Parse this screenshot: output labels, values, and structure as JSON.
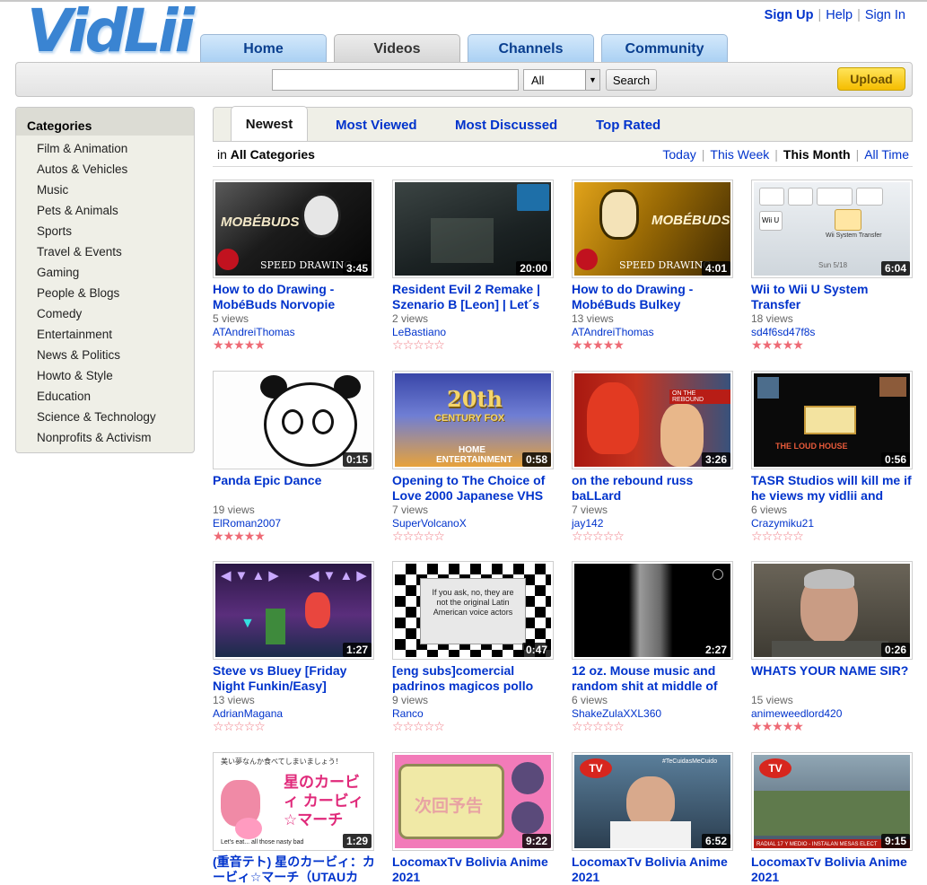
{
  "brand": {
    "logo": "VidLii"
  },
  "header": {
    "links": {
      "signup": "Sign Up",
      "help": "Help",
      "signin": "Sign In"
    },
    "tabs": [
      "Home",
      "Videos",
      "Channels",
      "Community"
    ]
  },
  "search": {
    "value": "",
    "category": "All",
    "button": "Search",
    "upload": "Upload"
  },
  "sidebar": {
    "title": "Categories",
    "items": [
      "Film & Animation",
      "Autos & Vehicles",
      "Music",
      "Pets & Animals",
      "Sports",
      "Travel & Events",
      "Gaming",
      "People & Blogs",
      "Comedy",
      "Entertainment",
      "News & Politics",
      "Howto & Style",
      "Education",
      "Science & Technology",
      "Nonprofits & Activism"
    ]
  },
  "subtabs": [
    "Newest",
    "Most Viewed",
    "Most Discussed",
    "Top Rated"
  ],
  "filter": {
    "prefix": "in",
    "category": "All Categories",
    "time": [
      "Today",
      "This Week",
      "This Month",
      "All Time"
    ]
  },
  "videos": [
    {
      "title": "How to do Drawing - MobéBuds Norvopie",
      "duration": "3:45",
      "views": "5 views",
      "user": "ATAndreiThomas",
      "rating": 5
    },
    {
      "title": "Resident Evil 2 Remake | Szenario B [Leon] | Let´s",
      "duration": "20:00",
      "views": "2 views",
      "user": "LeBastiano",
      "rating": 0
    },
    {
      "title": "How to do Drawing - MobéBuds Bulkey",
      "duration": "4:01",
      "views": "13 views",
      "user": "ATAndreiThomas",
      "rating": 5
    },
    {
      "title": "Wii to Wii U System Transfer",
      "duration": "6:04",
      "views": "18 views",
      "user": "sd4f6sd47f8s",
      "rating": 5
    },
    {
      "title": "Panda Epic Dance",
      "duration": "0:15",
      "views": "19 views",
      "user": "ElRoman2007",
      "rating": 5
    },
    {
      "title": "Opening to The Choice of Love 2000 Japanese VHS",
      "duration": "0:58",
      "views": "7 views",
      "user": "SuperVolcanoX",
      "rating": 0
    },
    {
      "title": "on the rebound russ baLLard",
      "duration": "3:26",
      "views": "7 views",
      "user": "jay142",
      "rating": 0
    },
    {
      "title": "TASR Studios will kill me if he views my vidlii and",
      "duration": "0:56",
      "views": "6 views",
      "user": "Crazymiku21",
      "rating": 0
    },
    {
      "title": "Steve vs Bluey [Friday Night Funkin/Easy]",
      "duration": "1:27",
      "views": "13 views",
      "user": "AdrianMagana",
      "rating": 0
    },
    {
      "title": "[eng subs]comercial padrinos magicos pollo",
      "duration": "0:47",
      "views": "9 views",
      "user": "Ranco",
      "rating": 0
    },
    {
      "title": "12 oz. Mouse music and random shit at middle of",
      "duration": "2:27",
      "views": "6 views",
      "user": "ShakeZulaXXL360",
      "rating": 0
    },
    {
      "title": "WHATS YOUR NAME SIR?",
      "duration": "0:26",
      "views": "15 views",
      "user": "animeweedlord420",
      "rating": 5
    },
    {
      "title": "(重音テト) 星のカービィ：カービィ☆マーチ（UTAUカ",
      "duration": "1:29",
      "views": "",
      "user": "",
      "rating": 0
    },
    {
      "title": "LocomaxTv Bolivia Anime 2021",
      "duration": "9:22",
      "views": "",
      "user": "",
      "rating": 0
    },
    {
      "title": "LocomaxTv Bolivia Anime 2021",
      "duration": "6:52",
      "views": "",
      "user": "",
      "rating": 0
    },
    {
      "title": "LocomaxTv Bolivia Anime 2021",
      "duration": "9:15",
      "views": "",
      "user": "",
      "rating": 0
    }
  ],
  "thumb_text": {
    "mobe": "MOBÉBUDS",
    "speed": "SPEED DRAWING",
    "wii": "Wii U",
    "wii_caption": "Wii System Transfer",
    "wii_date": "Sun 5/18",
    "fox_top": "20th",
    "fox_mid": "CENTURY FOX",
    "fox_bottom": "HOME ENTERTAINMENT",
    "rebound": "ON THE REBOUND",
    "loud": "THE LOUD HOUSE",
    "subs": "If you ask, no, they are not the original Latin American voice actors",
    "anime_top": "Let's eat... all those nasty bad",
    "anime_jp": "星のカービィ カービィ☆マーチ",
    "yokoku": "次回予告",
    "tv_tag": "#TeCuidasMeCuido",
    "tv_caption": "RADIAL 17 Y MEDIO - INSTALAN MESAS ELECT"
  }
}
